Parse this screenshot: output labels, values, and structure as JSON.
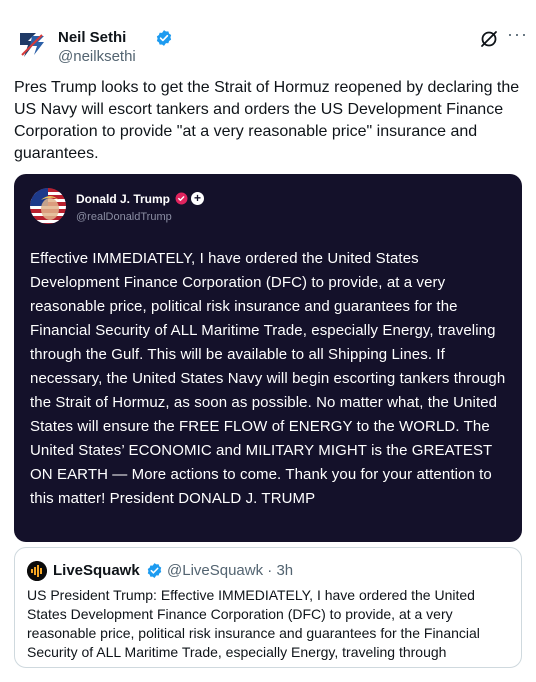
{
  "post": {
    "author_name": "Neil Sethi",
    "author_handle": "@neilksethi",
    "text": "Pres Trump looks to get the Strait of Hormuz reopened by declaring the US Navy will escort tankers and orders the US Development Finance Corporation to provide \"at a very reasonable price\" insurance and guarantees.",
    "more_label": "···",
    "icons": [
      "avatar-logo",
      "verified-badge",
      "grok-icon",
      "more-icon"
    ]
  },
  "embed": {
    "author_name": "Donald J. Trump",
    "author_handle": "@realDonaldTrump",
    "plus_label": "+",
    "body": "Effective IMMEDIATELY, I have ordered the United States Development Finance Corporation (DFC) to provide, at a very reasonable price, political risk insurance and guarantees for the Financial Security of ALL Maritime Trade, especially Energy, traveling through the Gulf. This will be available to all Shipping Lines. If necessary, the United States Navy will begin escorting tankers through the Strait of Hormuz, as soon as possible. No matter what, the United States will ensure the FREE FLOW of ENERGY to the WORLD. The United States’ ECONOMIC and MILITARY MIGHT is the GREATEST ON EARTH — More actions to come. Thank you for your attention to this matter! President DONALD J. TRUMP"
  },
  "quote": {
    "author_name": "LiveSquawk",
    "meta": "@LiveSquawk · 3h",
    "text": "US President Trump: Effective IMMEDIATELY, I have ordered the United States Development Finance Corporation (DFC) to provide, at a very reasonable price, political risk insurance and guarantees for the Financial Security of ALL Maritime Trade, especially Energy, traveling through"
  },
  "colors": {
    "verified_blue": "#1d9bf0",
    "embed_background": "#14112a",
    "secondary_text": "#536471",
    "affiliate_pink": "#e0245e"
  }
}
